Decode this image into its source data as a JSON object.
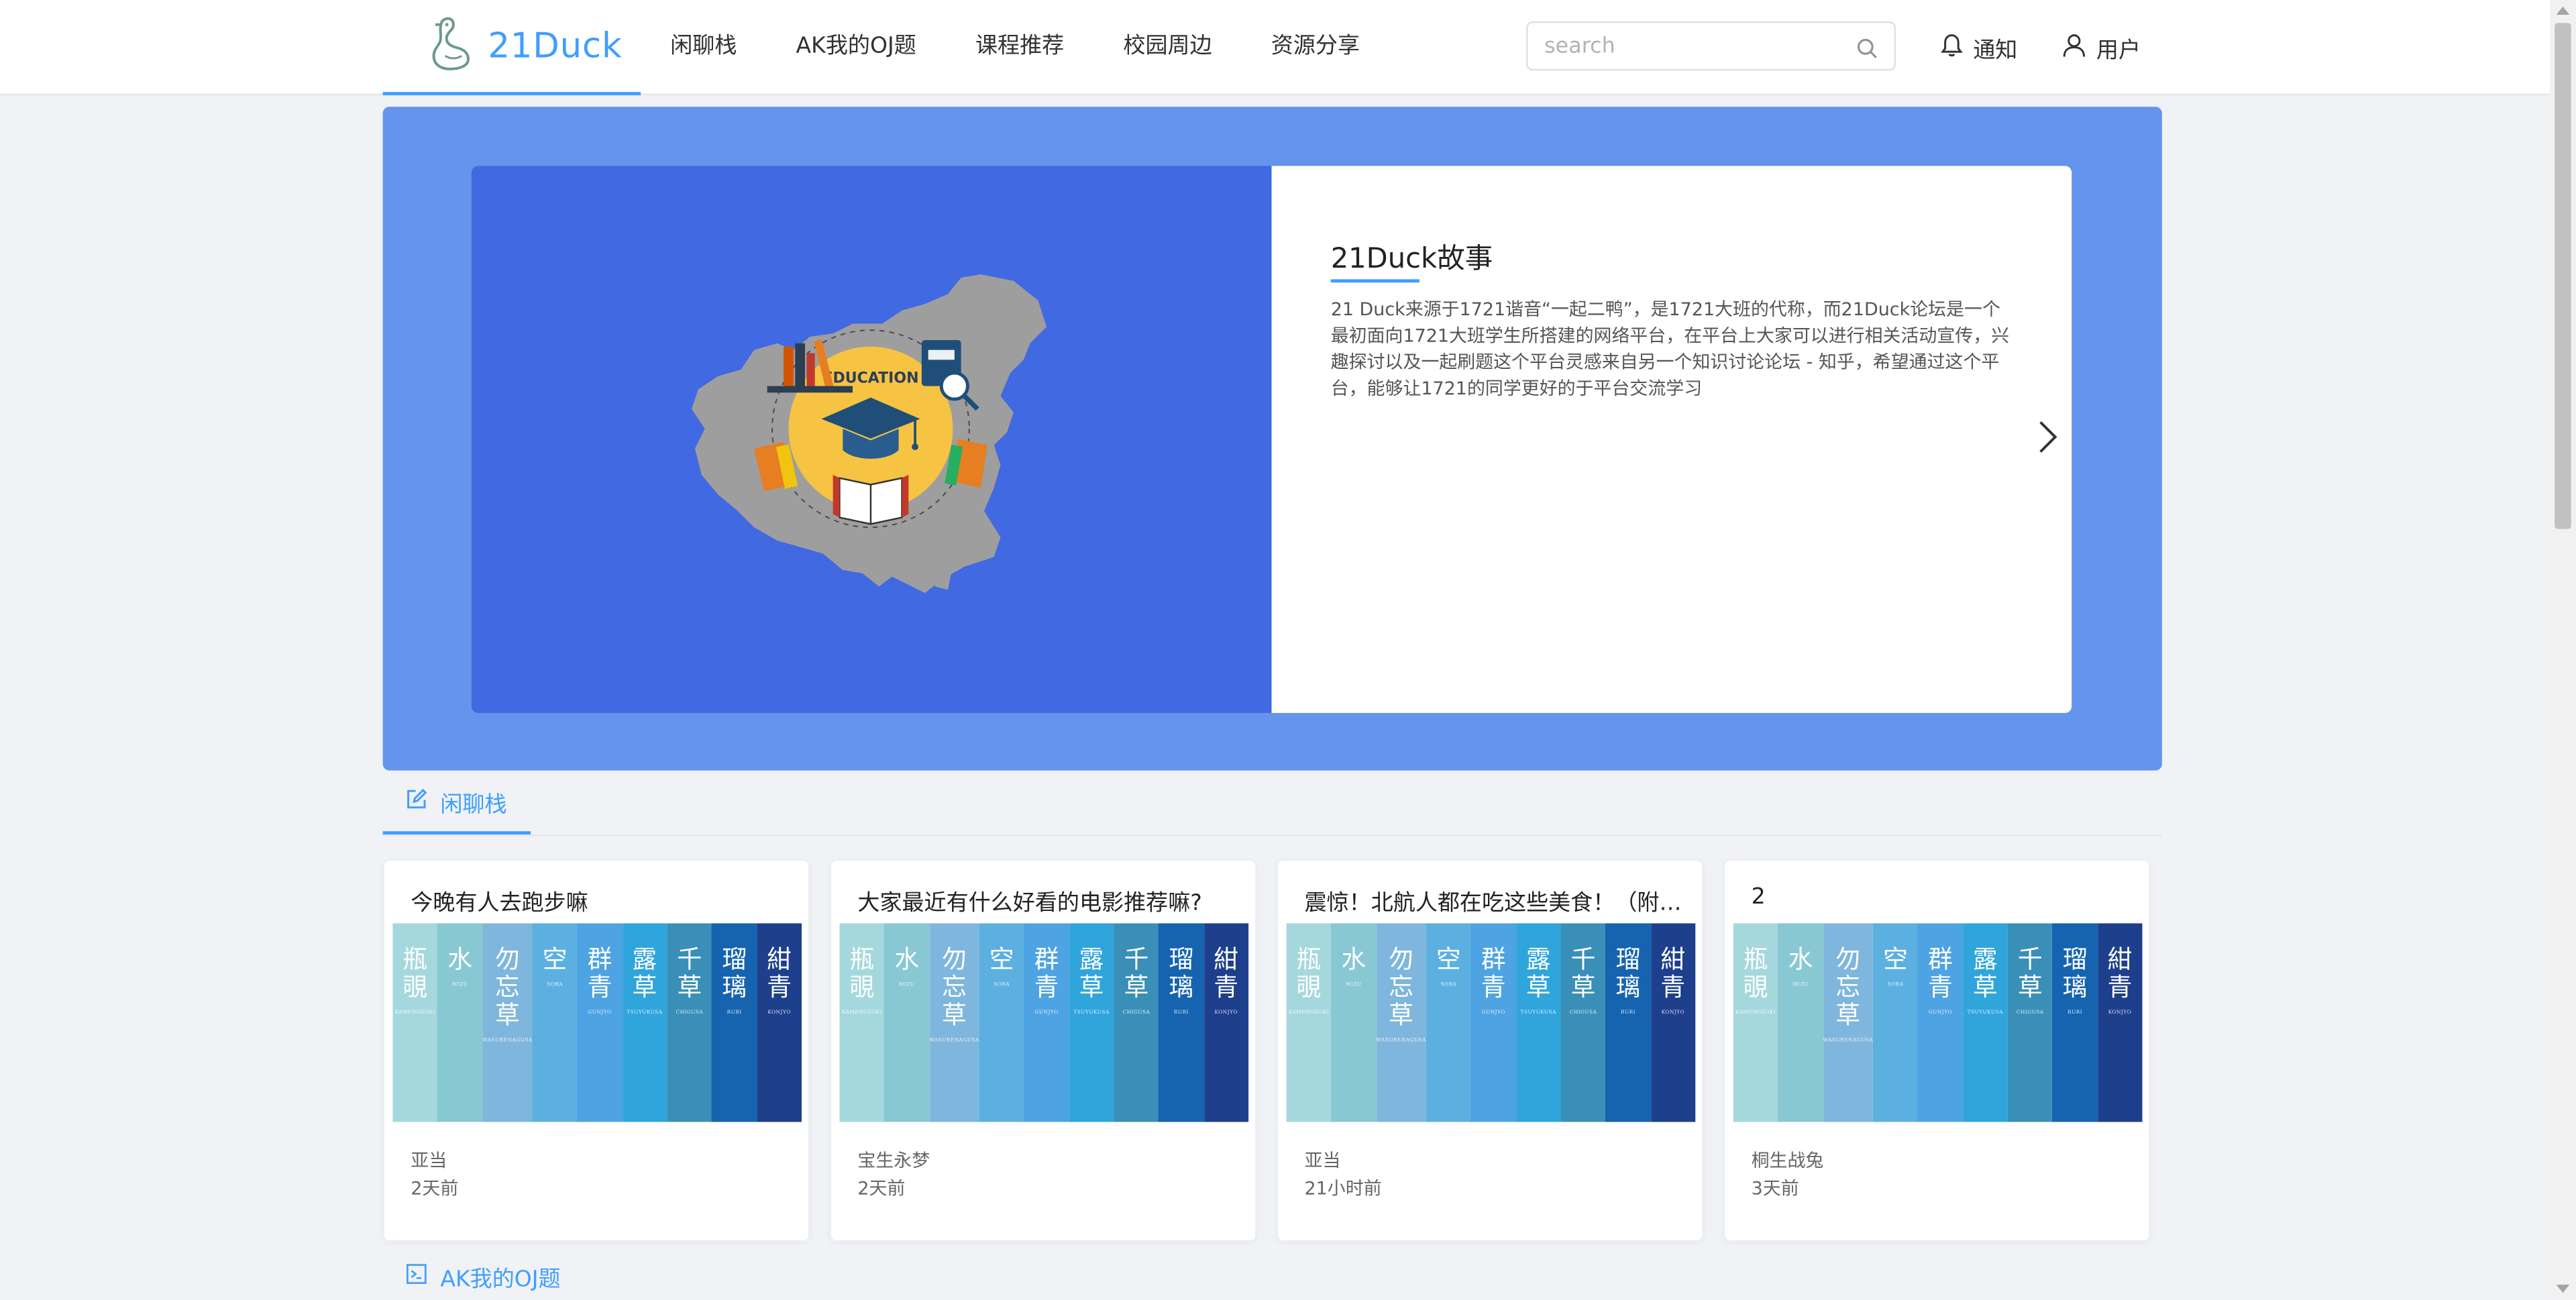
{
  "brand": {
    "name": "21Duck",
    "accent": "#409eff"
  },
  "nav": {
    "items": [
      {
        "label": "闲聊栈"
      },
      {
        "label": "AK我的OJ题"
      },
      {
        "label": "课程推荐"
      },
      {
        "label": "校园周边"
      },
      {
        "label": "资源分享"
      }
    ]
  },
  "search": {
    "placeholder": "search",
    "value": ""
  },
  "header": {
    "notify_label": "通知",
    "user_label": "用户"
  },
  "banner": {
    "bg_color": "#6494ec",
    "left_color": "#4169e1",
    "image_icon": "education-map-illustration",
    "image_text": "EDUCATION",
    "title": "21Duck故事",
    "text": "21 Duck来源于1721谐音“一起二鸭”，是1721大班的代称，而21Duck论坛是一个最初面向1721大班学生所搭建的网络平台，在平台上大家可以进行相关活动宣传，兴趣探讨以及一起刷题这个平台灵感来自另一个知识讨论论坛 - 知乎，希望通过这个平台，能够让1721的同学更好的于平台交流学习"
  },
  "sections": {
    "chat": {
      "label": "闲聊栈",
      "icon": "edit-icon"
    },
    "oj": {
      "label": "AK我的OJ题",
      "icon": "terminal-icon"
    }
  },
  "card_image": {
    "strips": [
      {
        "zh": "瓶覗",
        "en": "KAMENOZOKI",
        "color": "#a5d8dd"
      },
      {
        "zh": "水",
        "en": "MIZU",
        "color": "#87c8d3"
      },
      {
        "zh": "勿忘草",
        "en": "WASURENAGUSA",
        "color": "#7fb6dd"
      },
      {
        "zh": "空",
        "en": "SORA",
        "color": "#5bb0e0"
      },
      {
        "zh": "群青",
        "en": "GUNJYO",
        "color": "#4ea3e2"
      },
      {
        "zh": "露草",
        "en": "TSUYUKUSA",
        "color": "#2fa5dc"
      },
      {
        "zh": "千草",
        "en": "CHIGUSA",
        "color": "#3a8fb8"
      },
      {
        "zh": "瑠璃",
        "en": "RURI",
        "color": "#1664b0"
      },
      {
        "zh": "紺青",
        "en": "KONJYO",
        "color": "#1e3f8c"
      }
    ]
  },
  "posts": [
    {
      "title": "今晚有人去跑步嘛",
      "author": "亚当",
      "time": "2天前"
    },
    {
      "title": "大家最近有什么好看的电影推荐嘛?",
      "author": "宝生永梦",
      "time": "2天前"
    },
    {
      "title": "震惊！北航人都在吃这些美食！（附地图）",
      "author": "亚当",
      "time": "21小时前"
    },
    {
      "title": "2",
      "author": "桐生战兔",
      "time": "3天前"
    }
  ]
}
